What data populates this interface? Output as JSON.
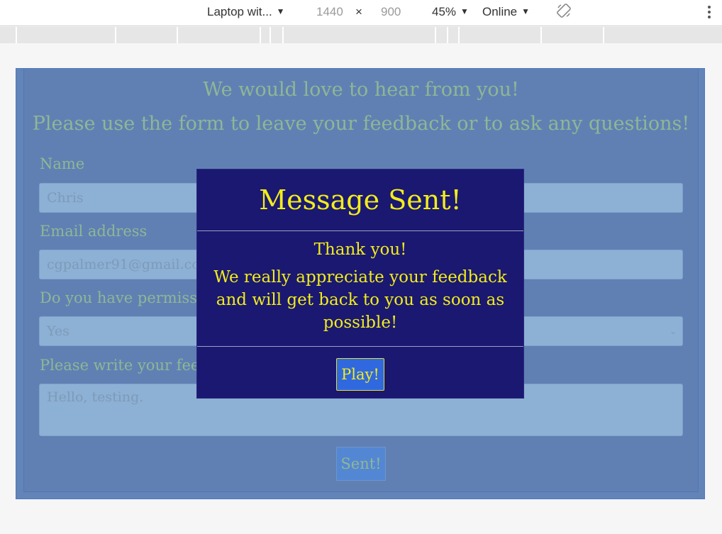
{
  "devtools": {
    "device": "Laptop wit...",
    "width": "1440",
    "times": "×",
    "height": "900",
    "zoom": "45%",
    "network": "Online"
  },
  "page": {
    "heading1": "We would love to hear from you!",
    "heading2": "Please use the form to leave your feedback or to ask any questions!",
    "name_label": "Name",
    "name_value": "Chris",
    "email_label": "Email address",
    "email_value": "cgpalmer91@gmail.com",
    "permission_label": "Do you have permissio",
    "permission_value": "Yes",
    "feedback_label": "Please write your feedb",
    "feedback_value": "Hello, testing.",
    "submit_label": "Sent!"
  },
  "modal": {
    "title": "Message Sent!",
    "thanks": "Thank you!",
    "message": "We really appreciate your feedback and will get back to you as soon as possible!",
    "button": "Play!"
  },
  "colors": {
    "overlay_blue": "#5e80b2",
    "faded_text": "#8eb794",
    "modal_bg": "#1a1870",
    "modal_text": "#f2ec1c",
    "play_button": "#3068e0"
  }
}
